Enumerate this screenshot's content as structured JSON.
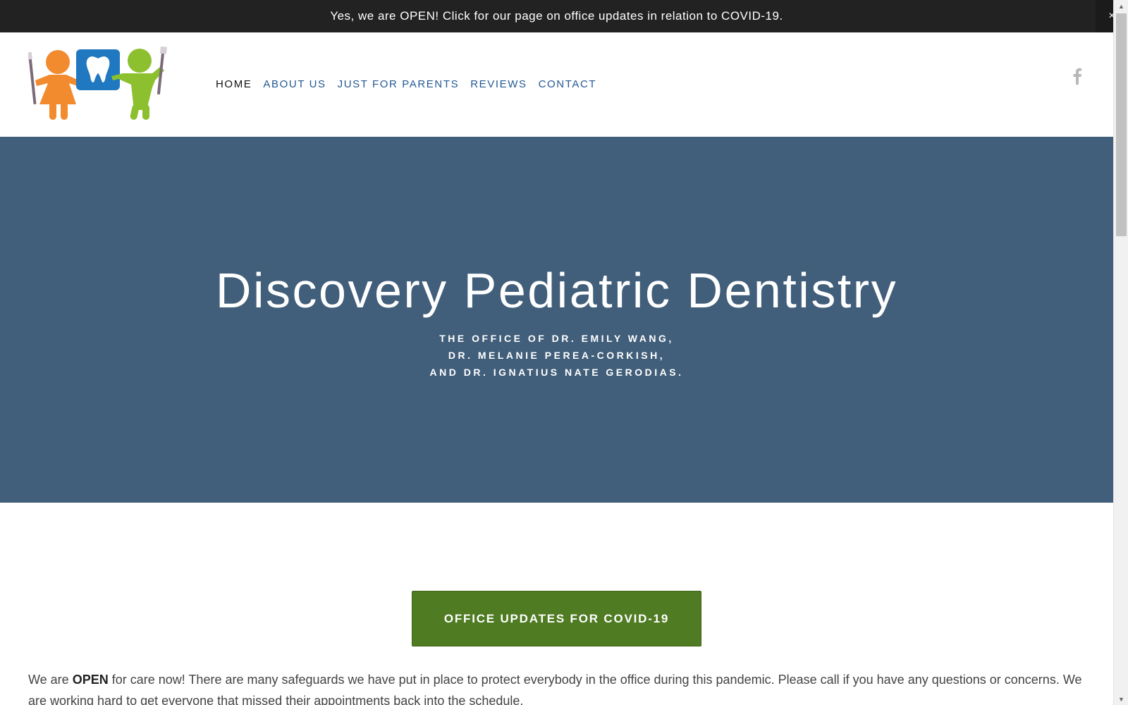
{
  "announcement": {
    "text": "Yes, we are OPEN! Click for our page on office updates in relation to COVID-19.",
    "close_glyph": "×"
  },
  "nav": {
    "items": [
      {
        "label": "HOME",
        "active": true
      },
      {
        "label": "ABOUT US",
        "active": false
      },
      {
        "label": "JUST FOR PARENTS",
        "active": false
      },
      {
        "label": "REVIEWS",
        "active": false
      },
      {
        "label": "CONTACT",
        "active": false
      }
    ],
    "social_icon": "facebook-icon"
  },
  "hero": {
    "title": "Discovery Pediatric Dentistry",
    "subtitle_lines": [
      "THE OFFICE OF DR. EMILY WANG,",
      "DR. MELANIE PEREA-CORKISH,",
      "AND DR. IGNATIUS NATE GERODIAS."
    ],
    "background_color": "#415e7a"
  },
  "cta": {
    "label": "OFFICE UPDATES FOR COVID-19",
    "color": "#4f7b23"
  },
  "body": {
    "intro": "We are ",
    "intro_bold": "OPEN",
    "rest": " for care now! There are many safeguards we have put in place to protect everybody in the office during this pandemic. Please call if you have any questions or concerns.  We are working hard to get everyone that missed their appointments back into the schedule."
  },
  "colors": {
    "nav_link": "#235894",
    "announce_bg": "#222222"
  }
}
